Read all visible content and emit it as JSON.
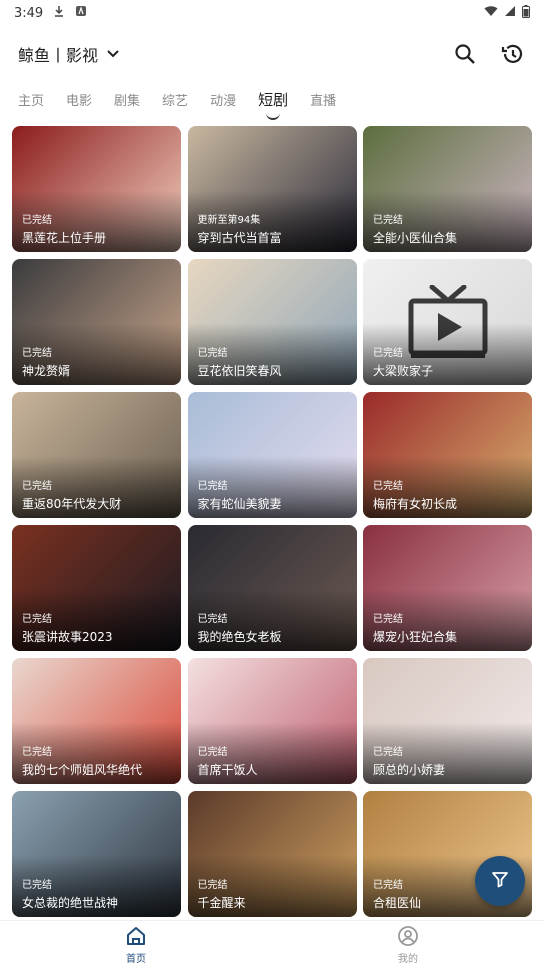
{
  "status": {
    "time": "3:49"
  },
  "header": {
    "brand": "鲸鱼丨影视"
  },
  "tabs": [
    "主页",
    "电影",
    "剧集",
    "综艺",
    "动漫",
    "短剧",
    "直播"
  ],
  "active_tab_index": 5,
  "cards": [
    {
      "badge": "已完结",
      "title": "黑莲花上位手册",
      "bg": "#8b1c1c",
      "bg2": "#f2d0c0"
    },
    {
      "badge": "更新至第94集",
      "title": "穿到古代当首富",
      "bg": "#c9b8a0",
      "bg2": "#2b2b3a"
    },
    {
      "badge": "已完结",
      "title": "全能小医仙合集",
      "bg": "#5c6e3e",
      "bg2": "#cdb7c2"
    },
    {
      "badge": "已完结",
      "title": "神龙赘婿",
      "bg": "#3b3b3d",
      "bg2": "#c9a68c"
    },
    {
      "badge": "已完结",
      "title": "豆花依旧笑春风",
      "bg": "#e7d7c0",
      "bg2": "#8fa6b8"
    },
    {
      "badge": "已完结",
      "title": "大梁败家子",
      "bg": "#f0f0f0",
      "bg2": "#d8d8d8"
    },
    {
      "badge": "已完结",
      "title": "重返80年代发大财",
      "bg": "#c8b49a",
      "bg2": "#6a5e50"
    },
    {
      "badge": "已完结",
      "title": "家有蛇仙美貌妻",
      "bg": "#a9bcd6",
      "bg2": "#e3dcf0"
    },
    {
      "badge": "已完结",
      "title": "梅府有女初长成",
      "bg": "#9a2a2a",
      "bg2": "#d8b070"
    },
    {
      "badge": "已完结",
      "title": "张震讲故事2023",
      "bg": "#7a3020",
      "bg2": "#1b1b22"
    },
    {
      "badge": "已完结",
      "title": "我的绝色女老板",
      "bg": "#2a2a32",
      "bg2": "#6c5a52"
    },
    {
      "badge": "已完结",
      "title": "爆宠小狂妃合集",
      "bg": "#8a3040",
      "bg2": "#d8a0a8"
    },
    {
      "badge": "已完结",
      "title": "我的七个师姐风华绝代",
      "bg": "#e9d7cf",
      "bg2": "#d94a3a"
    },
    {
      "badge": "已完结",
      "title": "首席干饭人",
      "bg": "#f3e0e0",
      "bg2": "#c06070"
    },
    {
      "badge": "已完结",
      "title": "顾总的小娇妻",
      "bg": "#d8c8c0",
      "bg2": "#f0e8e8"
    },
    {
      "badge": "已完结",
      "title": "女总裁的绝世战神",
      "bg": "#8aa0b0",
      "bg2": "#303842"
    },
    {
      "badge": "已完结",
      "title": "千金醒来",
      "bg": "#5a3a2a",
      "bg2": "#d0a060"
    },
    {
      "badge": "已完结",
      "title": "合租医仙",
      "bg": "#b08040",
      "bg2": "#f0c890"
    }
  ],
  "bottom_nav": [
    {
      "label": "首页",
      "active": true
    },
    {
      "label": "我的",
      "active": false
    }
  ],
  "colors": {
    "accent": "#1f4e7a"
  }
}
